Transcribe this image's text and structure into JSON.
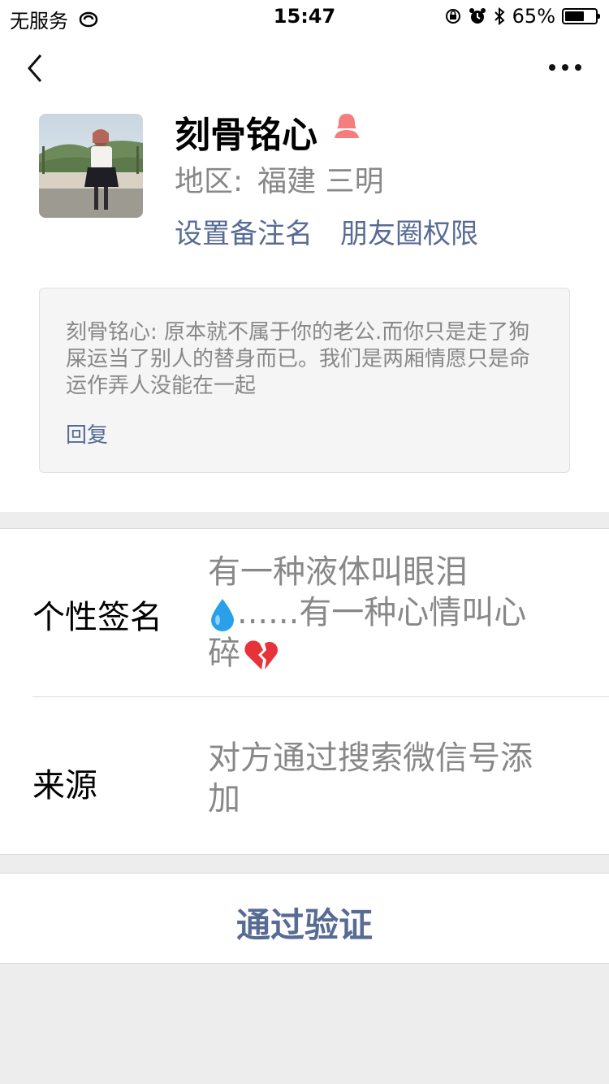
{
  "status_bar": {
    "carrier": "无服务",
    "time": "15:47",
    "battery_percent": "65%",
    "battery_level": 0.65
  },
  "profile": {
    "name": "刻骨铭心",
    "gender_icon": "female-icon",
    "region_label": "地区:",
    "region_value": "福建 三明",
    "link_remark": "设置备注名",
    "link_moments": "朋友圈权限"
  },
  "message": {
    "text": "刻骨铭心: 原本就不属于你的老公.而你只是走了狗屎运当了别人的替身而已。我们是两厢情愿只是命运作弄人没能在一起",
    "reply_label": "回复"
  },
  "info": {
    "signature_label": "个性签名",
    "signature_part1": "有一种液体叫眼泪",
    "signature_part2": "......有一种心情叫心碎",
    "source_label": "来源",
    "source_value": "对方通过搜索微信号添加"
  },
  "actions": {
    "verify_label": "通过验证"
  },
  "colors": {
    "link": "#576b95",
    "secondary_text": "#888888",
    "gender_icon": "#f37e7d",
    "droplet": "#2aa0ea",
    "broken_heart": "#e8323a"
  }
}
